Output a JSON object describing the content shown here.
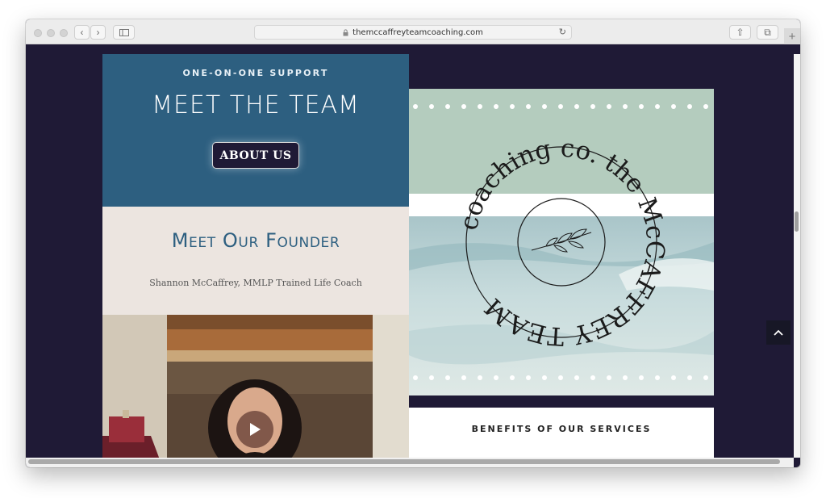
{
  "browser": {
    "url": "themccaffreyteamcoaching.com",
    "icons": {
      "lock": "lock-icon",
      "reload": "reload-icon",
      "back": "back-icon",
      "forward": "forward-icon",
      "sidebar": "sidebar-icon",
      "share": "share-icon",
      "tabs": "tabs-icon",
      "new_tab": "plus-icon"
    }
  },
  "team_section": {
    "kicker": "ONE-ON-ONE SUPPORT",
    "title": "MEET THE TEAM",
    "button_label": "ABOUT US"
  },
  "founder_section": {
    "title": "Meet Our Founder",
    "subtitle": "Shannon McCaffrey, MMLP Trained Life Coach"
  },
  "logo": {
    "text": "the McCAFFREY TEAM coaching co."
  },
  "benefits_section": {
    "title": "BENEFITS OF OUR SERVICES"
  },
  "colors": {
    "page_background": "#1f1a36",
    "team_panel": "#2d5f80",
    "founder_panel": "#ece5e0",
    "logo_panel_top": "#b4ccbe"
  }
}
